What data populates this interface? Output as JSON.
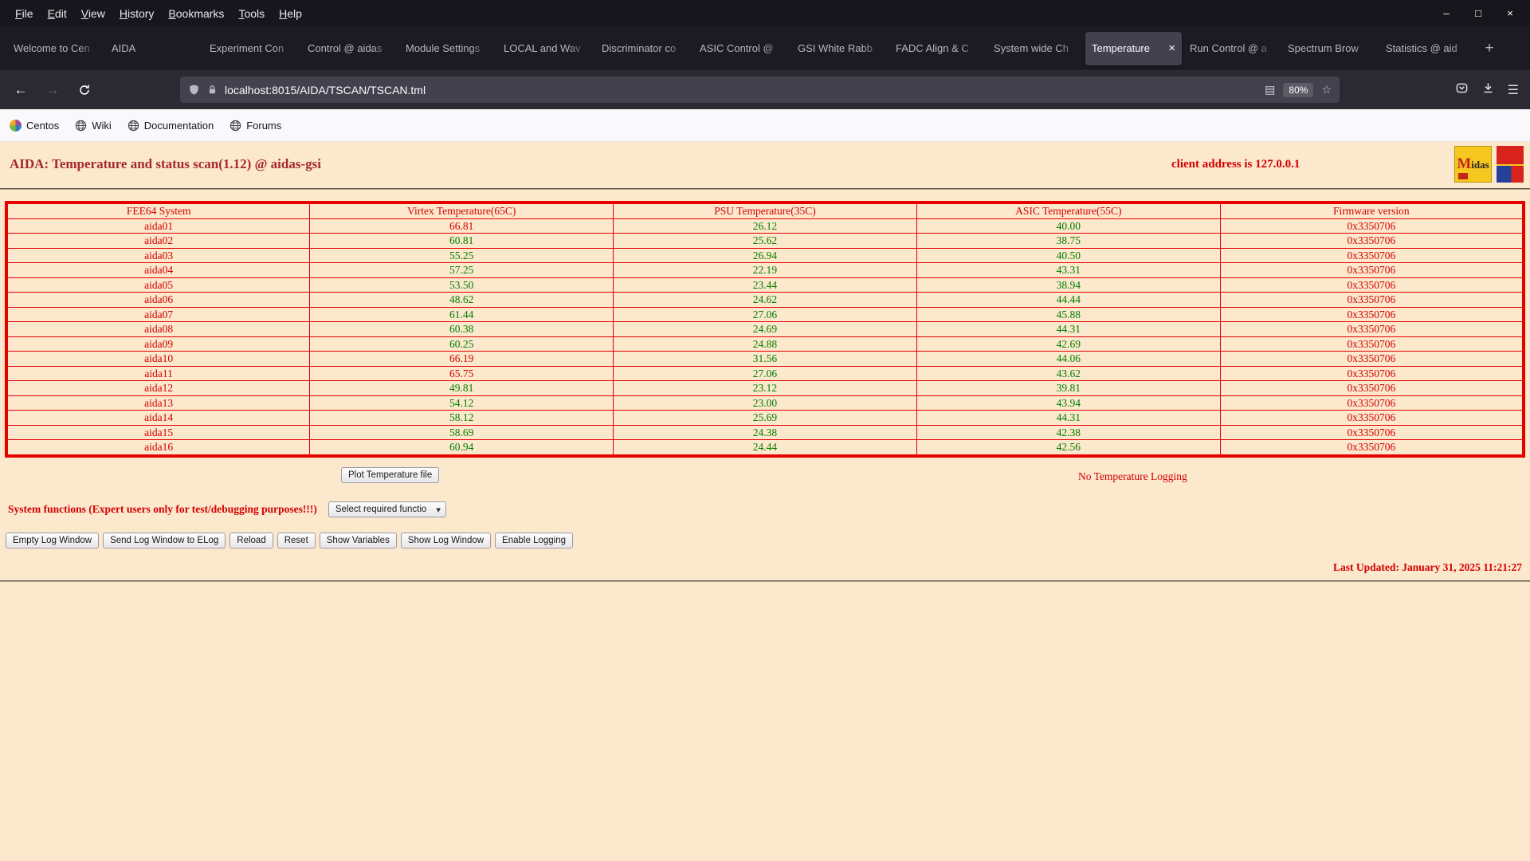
{
  "browser": {
    "menu": [
      "File",
      "Edit",
      "View",
      "History",
      "Bookmarks",
      "Tools",
      "Help"
    ],
    "window_controls": [
      {
        "name": "minimize",
        "glyph": "–"
      },
      {
        "name": "maximize",
        "glyph": "□"
      },
      {
        "name": "close",
        "glyph": "×"
      }
    ],
    "tabs": [
      {
        "label": "Welcome to Cen",
        "active": false
      },
      {
        "label": "AIDA",
        "active": false
      },
      {
        "label": "Experiment Con",
        "active": false
      },
      {
        "label": "Control @ aidas",
        "active": false
      },
      {
        "label": "Module Settings",
        "active": false
      },
      {
        "label": "LOCAL and Wav",
        "active": false
      },
      {
        "label": "Discriminator co",
        "active": false
      },
      {
        "label": "ASIC Control @",
        "active": false
      },
      {
        "label": "GSI White Rabb",
        "active": false
      },
      {
        "label": "FADC Align & C",
        "active": false
      },
      {
        "label": "System wide Ch",
        "active": false
      },
      {
        "label": "Temperature",
        "active": true
      },
      {
        "label": "Run Control @ a",
        "active": false
      },
      {
        "label": "Spectrum Brow",
        "active": false
      },
      {
        "label": "Statistics @ aid",
        "active": false
      }
    ],
    "icons": {
      "back": "←",
      "forward": "→",
      "star": "☆",
      "reader": "▤",
      "menu": "☰",
      "new_tab": "+",
      "close_tab": "×",
      "dropdown": "▾"
    },
    "url": "localhost:8015/AIDA/TSCAN/TSCAN.tml",
    "zoom": "80%",
    "bookmarks": [
      "Centos",
      "Wiki",
      "Documentation",
      "Forums"
    ]
  },
  "page": {
    "title": "AIDA: Temperature and status scan(1.12) @ aidas-gsi",
    "client_address": "client address is 127.0.0.1",
    "logos": {
      "midas": "Midas"
    },
    "table": {
      "headers": [
        "FEE64 System",
        "Virtex Temperature(65C)",
        "PSU Temperature(35C)",
        "ASIC Temperature(55C)",
        "Firmware version"
      ],
      "rows": [
        {
          "cells": [
            "aida01",
            "66.81",
            "26.12",
            "40.00",
            "0x3350706"
          ],
          "colors": [
            "red",
            "red",
            "green",
            "green",
            "red"
          ]
        },
        {
          "cells": [
            "aida02",
            "60.81",
            "25.62",
            "38.75",
            "0x3350706"
          ],
          "colors": [
            "red",
            "green",
            "green",
            "green",
            "red"
          ]
        },
        {
          "cells": [
            "aida03",
            "55.25",
            "26.94",
            "40.50",
            "0x3350706"
          ],
          "colors": [
            "red",
            "green",
            "green",
            "green",
            "red"
          ]
        },
        {
          "cells": [
            "aida04",
            "57.25",
            "22.19",
            "43.31",
            "0x3350706"
          ],
          "colors": [
            "red",
            "green",
            "green",
            "green",
            "red"
          ]
        },
        {
          "cells": [
            "aida05",
            "53.50",
            "23.44",
            "38.94",
            "0x3350706"
          ],
          "colors": [
            "red",
            "green",
            "green",
            "green",
            "red"
          ]
        },
        {
          "cells": [
            "aida06",
            "48.62",
            "24.62",
            "44.44",
            "0x3350706"
          ],
          "colors": [
            "red",
            "green",
            "green",
            "green",
            "red"
          ]
        },
        {
          "cells": [
            "aida07",
            "61.44",
            "27.06",
            "45.88",
            "0x3350706"
          ],
          "colors": [
            "red",
            "green",
            "green",
            "green",
            "red"
          ]
        },
        {
          "cells": [
            "aida08",
            "60.38",
            "24.69",
            "44.31",
            "0x3350706"
          ],
          "colors": [
            "red",
            "green",
            "green",
            "green",
            "red"
          ]
        },
        {
          "cells": [
            "aida09",
            "60.25",
            "24.88",
            "42.69",
            "0x3350706"
          ],
          "colors": [
            "red",
            "green",
            "green",
            "green",
            "red"
          ]
        },
        {
          "cells": [
            "aida10",
            "66.19",
            "31.56",
            "44.06",
            "0x3350706"
          ],
          "colors": [
            "red",
            "red",
            "green",
            "green",
            "red"
          ]
        },
        {
          "cells": [
            "aida11",
            "65.75",
            "27.06",
            "43.62",
            "0x3350706"
          ],
          "colors": [
            "red",
            "red",
            "green",
            "green",
            "red"
          ]
        },
        {
          "cells": [
            "aida12",
            "49.81",
            "23.12",
            "39.81",
            "0x3350706"
          ],
          "colors": [
            "red",
            "green",
            "green",
            "green",
            "red"
          ]
        },
        {
          "cells": [
            "aida13",
            "54.12",
            "23.00",
            "43.94",
            "0x3350706"
          ],
          "colors": [
            "red",
            "green",
            "green",
            "green",
            "red"
          ]
        },
        {
          "cells": [
            "aida14",
            "58.12",
            "25.69",
            "44.31",
            "0x3350706"
          ],
          "colors": [
            "red",
            "green",
            "green",
            "green",
            "red"
          ]
        },
        {
          "cells": [
            "aida15",
            "58.69",
            "24.38",
            "42.38",
            "0x3350706"
          ],
          "colors": [
            "red",
            "green",
            "green",
            "green",
            "red"
          ]
        },
        {
          "cells": [
            "aida16",
            "60.94",
            "24.44",
            "42.56",
            "0x3350706"
          ],
          "colors": [
            "red",
            "green",
            "green",
            "green",
            "red"
          ]
        }
      ]
    },
    "plot_button": "Plot Temperature file",
    "logging_status": "No Temperature Logging",
    "system_functions_label": "System functions (Expert users only for test/debugging purposes!!!)",
    "function_select": "Select required function",
    "action_buttons": [
      "Empty Log Window",
      "Send Log Window to ELog",
      "Reload",
      "Reset",
      "Show Variables",
      "Show Log Window",
      "Enable Logging"
    ],
    "last_updated": "Last Updated: January 31, 2025 11:21:27",
    "colors": {
      "red": "#d40000",
      "green": "#008000",
      "border": "#e60000",
      "title": "#a52a2a",
      "page_bg": "#fbe8cd"
    }
  }
}
